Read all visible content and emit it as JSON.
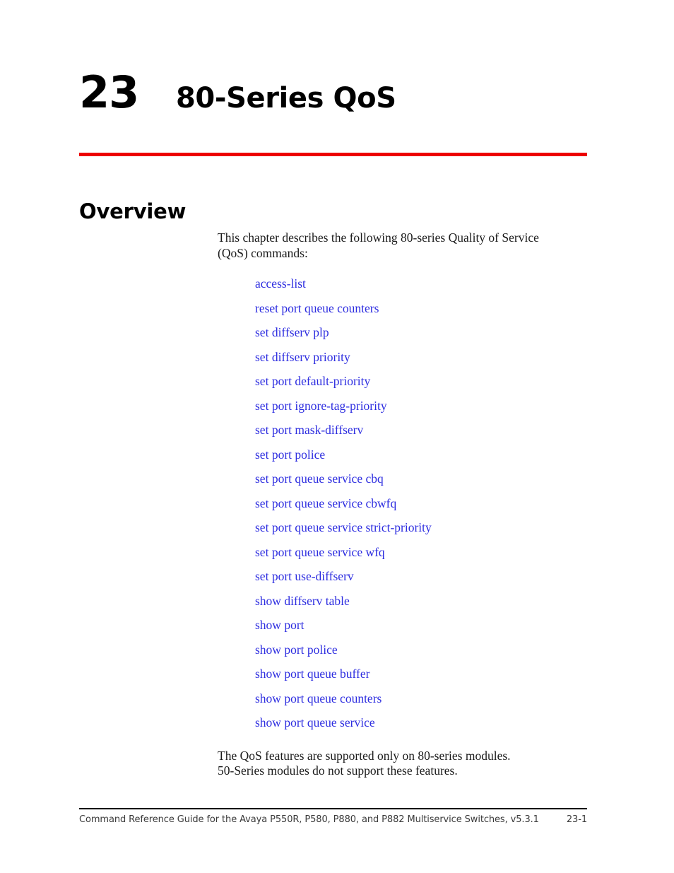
{
  "document": {
    "chapter_number": "23",
    "chapter_title": "80-Series QoS",
    "accent_color": "#ed0000",
    "link_color": "#2d2de0",
    "text_color": "#1a1a1a"
  },
  "section": {
    "heading": "Overview",
    "intro_paragraph": "This chapter describes the following 80-series Quality of Service\n(QoS) commands:",
    "closing_paragraph": "The QoS features are supported only on 80-series modules.\n50-Series modules do not support these features."
  },
  "commands": [
    {
      "label": "access-list"
    },
    {
      "label": "reset port queue counters"
    },
    {
      "label": "set diffserv plp"
    },
    {
      "label": "set diffserv priority"
    },
    {
      "label": "set port default-priority"
    },
    {
      "label": "set port ignore-tag-priority"
    },
    {
      "label": "set port mask-diffserv"
    },
    {
      "label": "set port police"
    },
    {
      "label": "set port queue service cbq"
    },
    {
      "label": "set port queue service cbwfq"
    },
    {
      "label": "set port queue service strict-priority"
    },
    {
      "label": "set port queue service wfq"
    },
    {
      "label": "set port use-diffserv"
    },
    {
      "label": "show diffserv table"
    },
    {
      "label": "show port"
    },
    {
      "label": "show port police"
    },
    {
      "label": "show port queue buffer"
    },
    {
      "label": "show port queue counters"
    },
    {
      "label": "show port queue service"
    }
  ],
  "footer": {
    "text": "Command Reference Guide for the Avaya P550R, P580, P880, and P882 Multiservice Switches, v5.3.1",
    "page_number": "23-1"
  }
}
